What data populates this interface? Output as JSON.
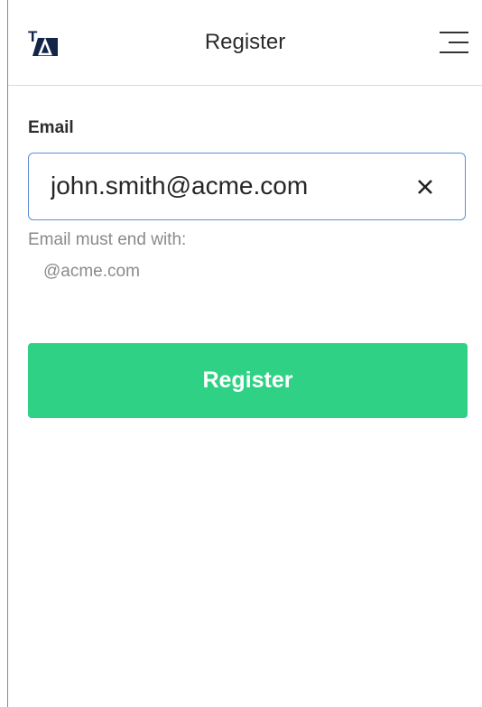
{
  "header": {
    "logo_text": "TA",
    "title": "Register",
    "menu_icon": "hamburger-menu-icon"
  },
  "form": {
    "email_label": "Email",
    "email_value": "john.smith@acme.com",
    "clear_icon": "close-icon",
    "hint": "Email must end with:",
    "allowed_domains": [
      "@acme.com"
    ],
    "submit_label": "Register"
  },
  "colors": {
    "accent_green": "#2fd285",
    "focus_border": "#5b8fd6",
    "logo_navy": "#13264a",
    "hint_gray": "#8a8a8a"
  }
}
